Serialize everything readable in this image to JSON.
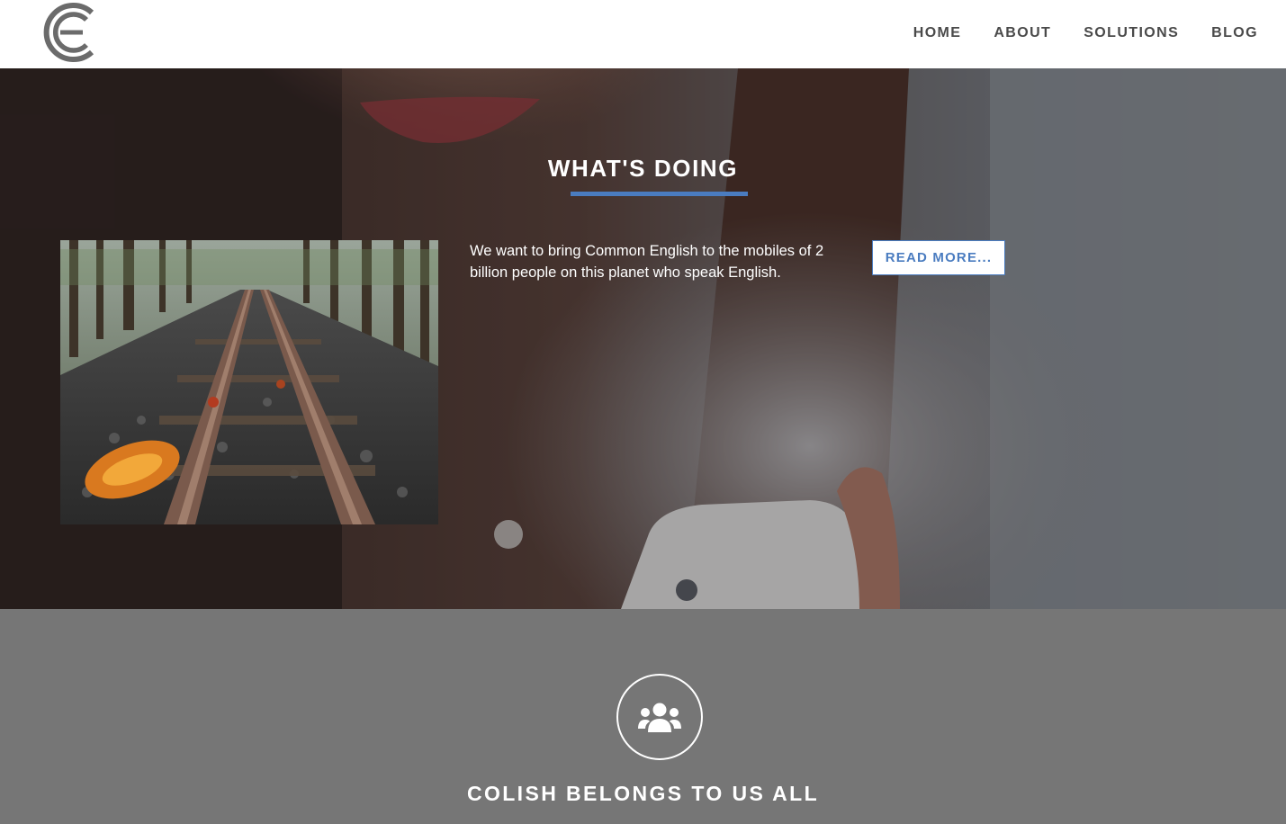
{
  "header": {
    "logo_icon": "ce-logo-icon",
    "nav": [
      {
        "label": "HOME"
      },
      {
        "label": "ABOUT"
      },
      {
        "label": "SOLUTIONS"
      },
      {
        "label": "BLOG"
      }
    ]
  },
  "hero": {
    "title": "WHAT'S DOING",
    "description": "We want to bring Common English to the mobiles of 2 billion people on this planet who speak English.",
    "read_more_label": "READ MORE...",
    "feature_image": "railway-tracks-photo",
    "background_image": "woman-with-phone-photo",
    "accent_color": "#4a7cc0"
  },
  "community": {
    "icon": "users-group-icon",
    "title": "COLISH BELONGS TO US ALL",
    "background_color": "#767676"
  }
}
